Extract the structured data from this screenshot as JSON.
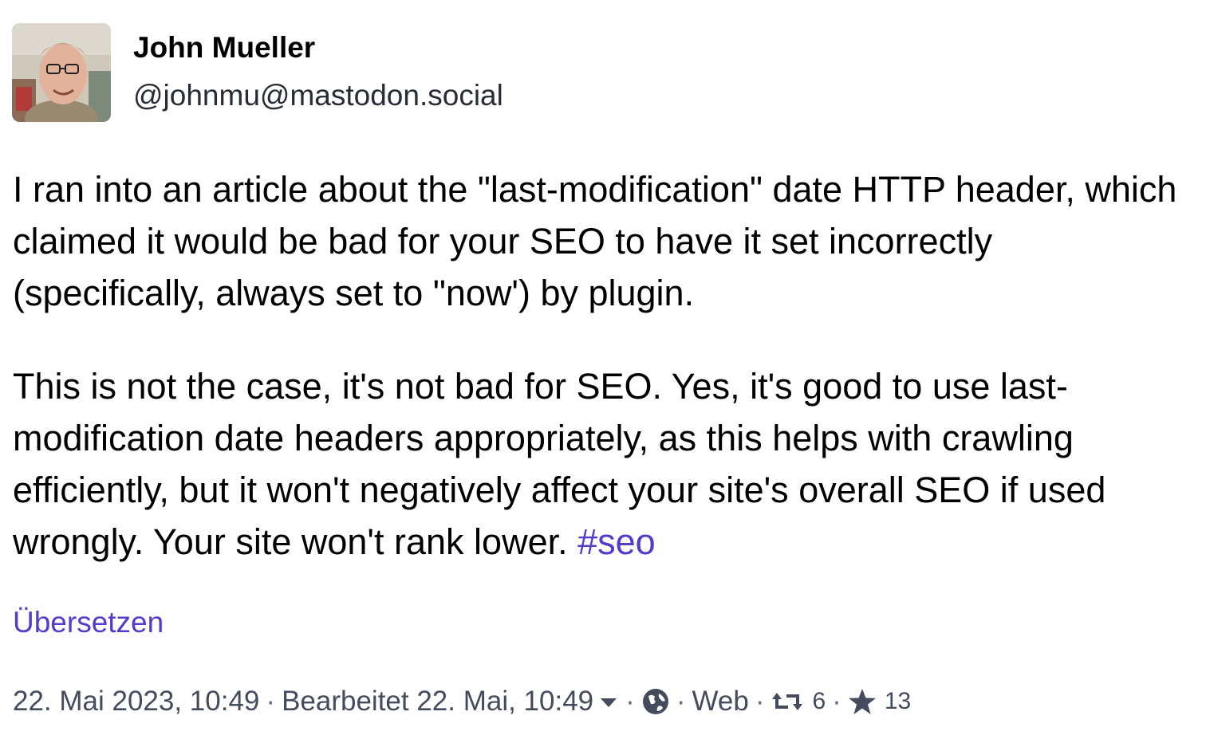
{
  "author": {
    "display_name": "John Mueller",
    "handle": "@johnmu@mastodon.social"
  },
  "post": {
    "paragraph_1": "I ran into an article about the \"last-modification\" date HTTP header, which claimed it would be bad for your SEO to have it set incorrectly (specifically, always set to \"now') by plugin.",
    "paragraph_2_text": "This is not the case, it's not bad for SEO. Yes, it's good to use last-modification date headers appropriately, as this helps with crawling efficiently, but it won't negatively affect your site's overall SEO if used wrongly. Your site won't rank lower. ",
    "hashtag": "#seo",
    "translate_label": "Übersetzen"
  },
  "meta": {
    "date": "22. Mai 2023, 10:49",
    "separator": "·",
    "edited": "Bearbeitet 22. Mai, 10:49",
    "application": "Web",
    "boosts": "6",
    "favourites": "13",
    "visibility_icon": "globe-icon",
    "edited_dropdown_icon": "caret-down-icon",
    "boost_icon": "retweet-icon",
    "favourite_icon": "star-icon"
  },
  "colors": {
    "link": "#563acc",
    "meta_text": "#444b5d",
    "text": "#000000"
  }
}
